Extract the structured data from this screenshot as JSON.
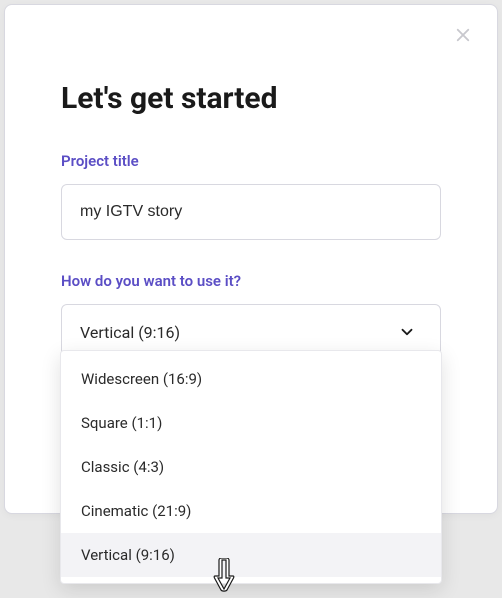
{
  "modal": {
    "title": "Let's get started",
    "close_label": "Close"
  },
  "project_title": {
    "label": "Project title",
    "value": "my IGTV story"
  },
  "usage": {
    "label": "How do you want to use it?",
    "selected": "Vertical (9:16)",
    "options": [
      "Widescreen (16:9)",
      "Square (1:1)",
      "Classic (4:3)",
      "Cinematic (21:9)",
      "Vertical (9:16)"
    ],
    "hovered_index": 4
  }
}
